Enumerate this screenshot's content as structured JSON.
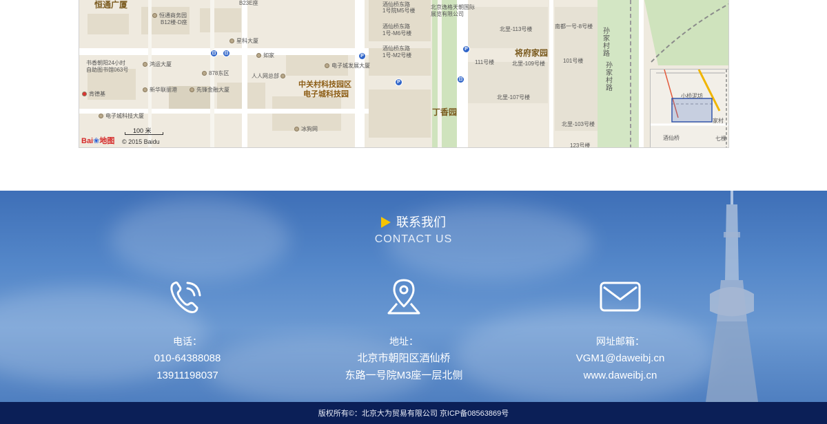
{
  "map": {
    "labels": {
      "hengtong_plaza": "恒通广厦",
      "hengtong_business": "恒通商务园",
      "b12": "B12楼-D座",
      "b23e": "B23E座",
      "xingke": "星科大厦",
      "rujia": "如家",
      "shuxiang": "书香朝阳24小时",
      "zizhu": "自助图书馆063号",
      "hongyun": "鸿运大厦",
      "d878": "878东区",
      "renren": "人人网总部",
      "xinhua": "新华联丽港",
      "xiandeng": "先锋金融大厦",
      "kendeji": "肯德基",
      "dianzicheng_dasha": "电子城科技大厦",
      "dianzicheng_fazhan": "电子城发展大厦",
      "zgc_area": "中关村科技园区",
      "dzc_area": "电子城科技园",
      "bingou": "冰狗网",
      "jxq_dong": "酒仙桥东路",
      "m5": "1号院M5号楼",
      "jxq_dong2": "酒仙桥东路",
      "m6": "1号-M6号楼",
      "jxq_dong3": "酒仙桥东路",
      "m2": "1号-M2号楼",
      "yige": "北京逸格天朝国际",
      "yige2": "展览有限公司",
      "jiangfu": "将府家园",
      "dingxiang": "丁香园",
      "beili113": "北里-113号楼",
      "nandu": "南都一号-8号楼",
      "l111": "111号楼",
      "beili109": "北里-109号楼",
      "l101": "101号楼",
      "beili107": "北里-107号楼",
      "beili103": "北里-103号楼",
      "l123": "123号楼",
      "sunjiacun": "孙家村路",
      "ov_xiaojiangqu": "小桥泥坊",
      "ov_jiujiacun": "家村",
      "ov_jxq": "酒仙桥",
      "ov_qi": "七棵"
    },
    "scale_text": "100 米",
    "logo_text": "Bai",
    "logo_text2": "地图",
    "copyright": "© 2015 Baidu"
  },
  "contact": {
    "title_cn": "联系我们",
    "title_en": "CONTACT US",
    "phone": {
      "icon": "phone-icon",
      "label": "电话：",
      "lines": [
        "010-64388088",
        "13911198037"
      ]
    },
    "address": {
      "icon": "location-pin-icon",
      "label": "地址：",
      "lines": [
        "北京市朝阳区酒仙桥",
        "东路一号院M3座一层北侧"
      ]
    },
    "web": {
      "icon": "mail-icon",
      "label": "网址邮箱：",
      "lines": [
        "VGM1@daweibj.cn",
        "www.daweibj.cn"
      ]
    }
  },
  "footer": {
    "text": "版权所有©：北京大为贸易有限公司 京ICP备08563869号"
  },
  "colors": {
    "contact_bg": "#4f7fc0",
    "footer_bg": "#0b1f57",
    "accent_triangle": "#f5c400"
  }
}
